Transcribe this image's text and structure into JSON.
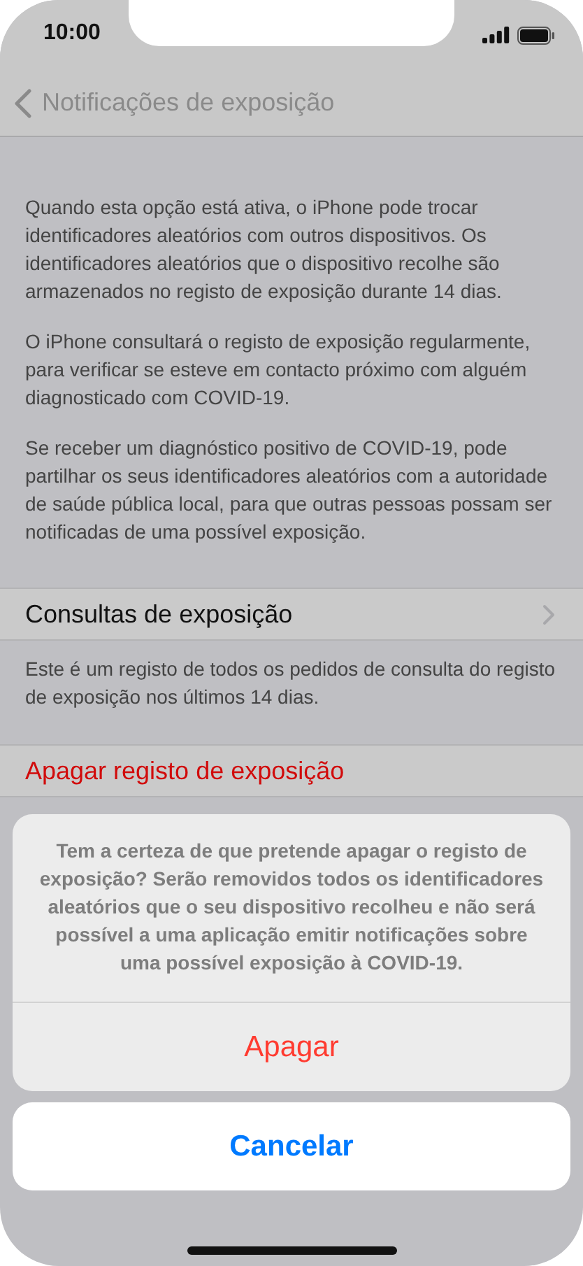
{
  "status_bar": {
    "time": "10:00"
  },
  "nav": {
    "title": "Notificações de exposição"
  },
  "description": [
    "Quando esta opção está ativa, o iPhone pode trocar identificadores aleatórios com outros dispositivos. Os identificadores aleatórios que o dispositivo recolhe são armazenados no registo de exposição durante 14 dias.",
    "O iPhone consultará o registo de exposição regularmente, para verificar se esteve em contacto próximo com alguém diagnosticado com COVID-19.",
    "Se receber um diagnóstico positivo de COVID-19, pode partilhar os seus identificadores aleatórios com a autoridade de saúde pública local, para que outras pessoas possam ser notificadas de uma possível exposição."
  ],
  "sections": [
    {
      "rows": [
        {
          "kind": "navigation",
          "label": "Consultas de exposição"
        }
      ],
      "footer": "Este é um registo de todos os pedidos de consulta do registo de exposição nos últimos 14 dias."
    },
    {
      "rows": [
        {
          "kind": "destructive",
          "label": "Apagar registo de exposição"
        }
      ]
    }
  ],
  "action_sheet": {
    "message": "Tem a certeza de que pretende apagar o registo de exposição? Serão removidos todos os identificadores aleatórios que o seu dispositivo recolheu e não será possível a uma aplicação emitir notificações sobre uma possível exposição à COVID-19.",
    "actions": [
      {
        "label": "Apagar",
        "kind": "destructive"
      }
    ],
    "cancel": "Cancelar"
  }
}
